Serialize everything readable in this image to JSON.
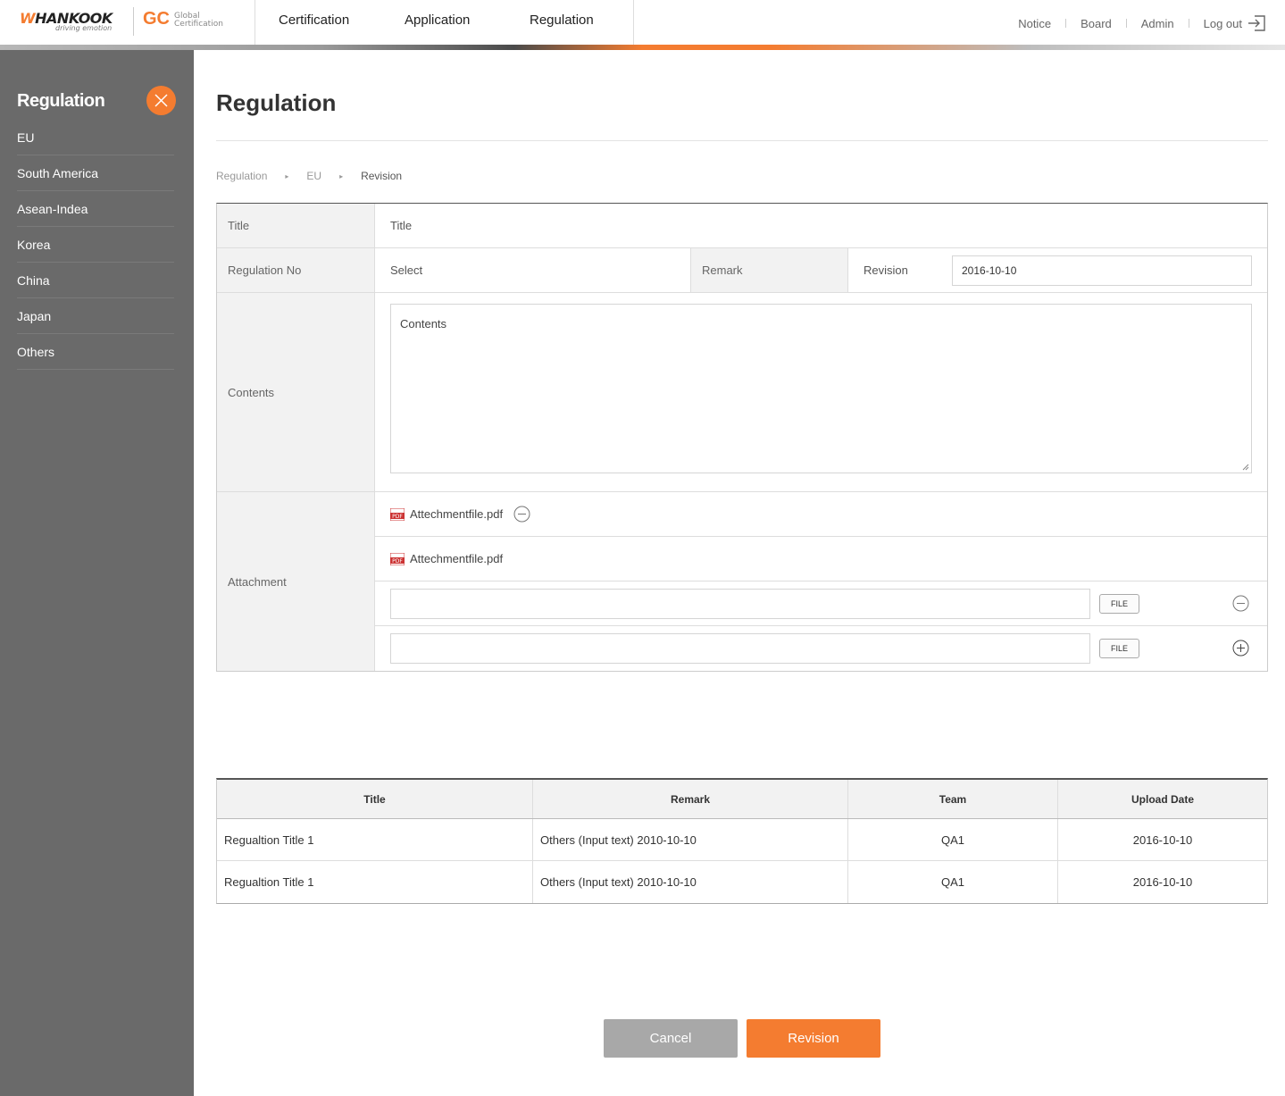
{
  "header": {
    "brand": "HANKOOK",
    "brand_tagline": "driving emotion",
    "gc_logo": "GC",
    "gc_sub1": "Global",
    "gc_sub2": "Certification",
    "nav": [
      "Certification",
      "Application",
      "Regulation"
    ],
    "util": {
      "notice": "Notice",
      "board": "Board",
      "admin": "Admin",
      "logout": "Log out"
    },
    "icons": {
      "logout": "logout-icon"
    },
    "accent_color": "#f47c30"
  },
  "sidebar": {
    "title": "Regulation",
    "close_icon": "close-icon",
    "items": [
      "EU",
      "South America",
      "Asean-Indea",
      "Korea",
      "China",
      "Japan",
      "Others"
    ],
    "bg_color": "#6a6a6a"
  },
  "page": {
    "title": "Regulation",
    "breadcrumb": [
      "Regulation",
      "EU",
      "Revision"
    ]
  },
  "form": {
    "title_label": "Title",
    "title_value": "Title",
    "regno_label": "Regulation No",
    "regno_value": "Select",
    "remark_label": "Remark",
    "revision_label": "Revision",
    "revision_value": "2016-10-10",
    "contents_label": "Contents",
    "contents_value": "Contents",
    "attachment_label": "Attachment",
    "attachments": [
      "Attechmentfile.pdf",
      "Attechmentfile.pdf"
    ],
    "file_button": "FILE"
  },
  "history": {
    "headers": [
      "Title",
      "Remark",
      "Team",
      "Upload Date"
    ],
    "rows": [
      [
        "Regualtion Title 1",
        "Others (Input text) 2010-10-10",
        "QA1",
        "2016-10-10"
      ],
      [
        "Regualtion Title 1",
        "Others (Input text) 2010-10-10",
        "QA1",
        "2016-10-10"
      ]
    ]
  },
  "buttons": {
    "cancel": "Cancel",
    "revision": "Revision"
  }
}
